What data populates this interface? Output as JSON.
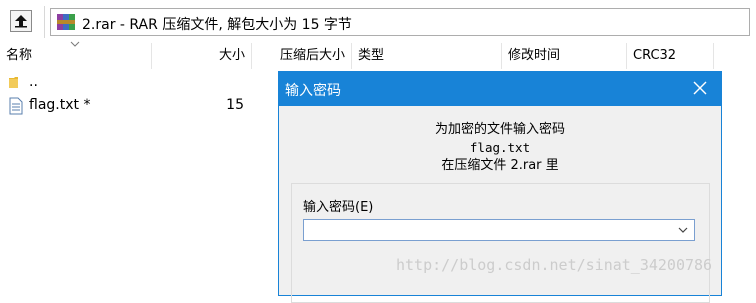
{
  "address_bar": {
    "path_text": "2.rar - RAR 压缩文件, 解包大小为 15 字节"
  },
  "columns": {
    "name": "名称",
    "size": "大小",
    "packed": "压缩后大小",
    "type": "类型",
    "modified": "修改时间",
    "crc": "CRC32"
  },
  "files": [
    {
      "name": "..",
      "size": ""
    },
    {
      "name": "flag.txt *",
      "size": "15"
    }
  ],
  "dialog": {
    "title": "输入密码",
    "prompt": "为加密的文件输入密码",
    "file_name": "flag.txt",
    "archive_line": "在压缩文件 2.rar 里",
    "field_label": "输入密码(E)",
    "password_value": ""
  },
  "watermark": "http://blog.csdn.net/sinat_34200786",
  "colors": {
    "accent": "#1883d7",
    "folder": "#e8b932"
  }
}
